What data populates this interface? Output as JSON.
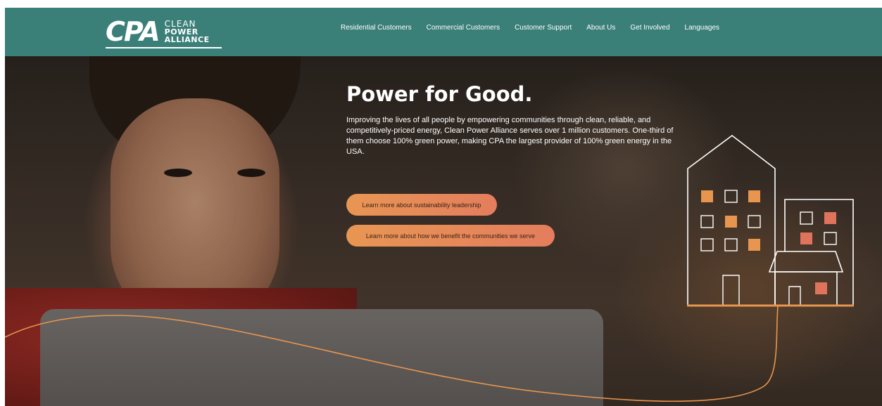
{
  "logo": {
    "mark": "CPA",
    "line1": "CLEAN",
    "line2": "POWER",
    "line3": "ALLIANCE"
  },
  "nav": {
    "items": [
      {
        "label": "Residential Customers"
      },
      {
        "label": "Commercial Customers"
      },
      {
        "label": "Customer Support"
      },
      {
        "label": "About Us"
      },
      {
        "label": "Get Involved"
      },
      {
        "label": "Languages"
      }
    ]
  },
  "hero": {
    "title": "Power for Good.",
    "body": "Improving the lives of all people by empowering communities through clean, reliable, and competitively-priced energy, Clean Power Alliance serves over 1 million customers. One-third of them choose 100% green power, making CPA the largest provider of 100% green energy in the USA.",
    "button_sustainability": "Learn more about sustainability leadership",
    "button_communities": "Learn more about how we benefit the communities we serve"
  },
  "colors": {
    "header_bg": "#3b7f79",
    "button_start": "#e89654",
    "button_end": "#e47d5d",
    "accent_orange": "#e8964f",
    "accent_coral": "#e0735c"
  }
}
